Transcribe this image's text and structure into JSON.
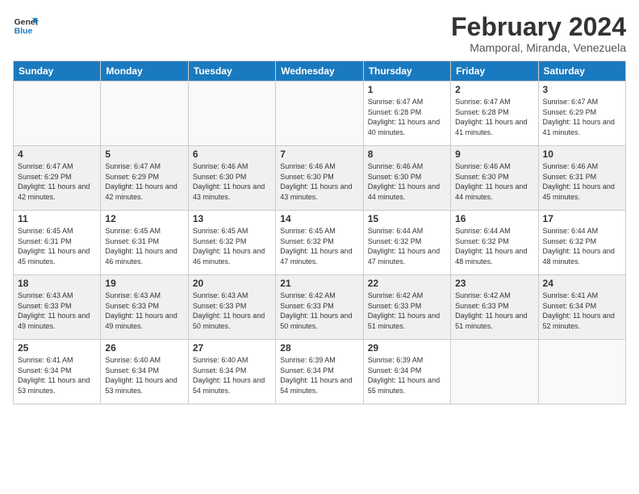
{
  "logo": {
    "line1": "General",
    "line2": "Blue"
  },
  "title": "February 2024",
  "subtitle": "Mamporal, Miranda, Venezuela",
  "days_of_week": [
    "Sunday",
    "Monday",
    "Tuesday",
    "Wednesday",
    "Thursday",
    "Friday",
    "Saturday"
  ],
  "weeks": [
    [
      {
        "day": "",
        "info": ""
      },
      {
        "day": "",
        "info": ""
      },
      {
        "day": "",
        "info": ""
      },
      {
        "day": "",
        "info": ""
      },
      {
        "day": "1",
        "info": "Sunrise: 6:47 AM\nSunset: 6:28 PM\nDaylight: 11 hours and 40 minutes."
      },
      {
        "day": "2",
        "info": "Sunrise: 6:47 AM\nSunset: 6:28 PM\nDaylight: 11 hours and 41 minutes."
      },
      {
        "day": "3",
        "info": "Sunrise: 6:47 AM\nSunset: 6:29 PM\nDaylight: 11 hours and 41 minutes."
      }
    ],
    [
      {
        "day": "4",
        "info": "Sunrise: 6:47 AM\nSunset: 6:29 PM\nDaylight: 11 hours and 42 minutes."
      },
      {
        "day": "5",
        "info": "Sunrise: 6:47 AM\nSunset: 6:29 PM\nDaylight: 11 hours and 42 minutes."
      },
      {
        "day": "6",
        "info": "Sunrise: 6:46 AM\nSunset: 6:30 PM\nDaylight: 11 hours and 43 minutes."
      },
      {
        "day": "7",
        "info": "Sunrise: 6:46 AM\nSunset: 6:30 PM\nDaylight: 11 hours and 43 minutes."
      },
      {
        "day": "8",
        "info": "Sunrise: 6:46 AM\nSunset: 6:30 PM\nDaylight: 11 hours and 44 minutes."
      },
      {
        "day": "9",
        "info": "Sunrise: 6:46 AM\nSunset: 6:30 PM\nDaylight: 11 hours and 44 minutes."
      },
      {
        "day": "10",
        "info": "Sunrise: 6:46 AM\nSunset: 6:31 PM\nDaylight: 11 hours and 45 minutes."
      }
    ],
    [
      {
        "day": "11",
        "info": "Sunrise: 6:45 AM\nSunset: 6:31 PM\nDaylight: 11 hours and 45 minutes."
      },
      {
        "day": "12",
        "info": "Sunrise: 6:45 AM\nSunset: 6:31 PM\nDaylight: 11 hours and 46 minutes."
      },
      {
        "day": "13",
        "info": "Sunrise: 6:45 AM\nSunset: 6:32 PM\nDaylight: 11 hours and 46 minutes."
      },
      {
        "day": "14",
        "info": "Sunrise: 6:45 AM\nSunset: 6:32 PM\nDaylight: 11 hours and 47 minutes."
      },
      {
        "day": "15",
        "info": "Sunrise: 6:44 AM\nSunset: 6:32 PM\nDaylight: 11 hours and 47 minutes."
      },
      {
        "day": "16",
        "info": "Sunrise: 6:44 AM\nSunset: 6:32 PM\nDaylight: 11 hours and 48 minutes."
      },
      {
        "day": "17",
        "info": "Sunrise: 6:44 AM\nSunset: 6:32 PM\nDaylight: 11 hours and 48 minutes."
      }
    ],
    [
      {
        "day": "18",
        "info": "Sunrise: 6:43 AM\nSunset: 6:33 PM\nDaylight: 11 hours and 49 minutes."
      },
      {
        "day": "19",
        "info": "Sunrise: 6:43 AM\nSunset: 6:33 PM\nDaylight: 11 hours and 49 minutes."
      },
      {
        "day": "20",
        "info": "Sunrise: 6:43 AM\nSunset: 6:33 PM\nDaylight: 11 hours and 50 minutes."
      },
      {
        "day": "21",
        "info": "Sunrise: 6:42 AM\nSunset: 6:33 PM\nDaylight: 11 hours and 50 minutes."
      },
      {
        "day": "22",
        "info": "Sunrise: 6:42 AM\nSunset: 6:33 PM\nDaylight: 11 hours and 51 minutes."
      },
      {
        "day": "23",
        "info": "Sunrise: 6:42 AM\nSunset: 6:33 PM\nDaylight: 11 hours and 51 minutes."
      },
      {
        "day": "24",
        "info": "Sunrise: 6:41 AM\nSunset: 6:34 PM\nDaylight: 11 hours and 52 minutes."
      }
    ],
    [
      {
        "day": "25",
        "info": "Sunrise: 6:41 AM\nSunset: 6:34 PM\nDaylight: 11 hours and 53 minutes."
      },
      {
        "day": "26",
        "info": "Sunrise: 6:40 AM\nSunset: 6:34 PM\nDaylight: 11 hours and 53 minutes."
      },
      {
        "day": "27",
        "info": "Sunrise: 6:40 AM\nSunset: 6:34 PM\nDaylight: 11 hours and 54 minutes."
      },
      {
        "day": "28",
        "info": "Sunrise: 6:39 AM\nSunset: 6:34 PM\nDaylight: 11 hours and 54 minutes."
      },
      {
        "day": "29",
        "info": "Sunrise: 6:39 AM\nSunset: 6:34 PM\nDaylight: 11 hours and 55 minutes."
      },
      {
        "day": "",
        "info": ""
      },
      {
        "day": "",
        "info": ""
      }
    ]
  ]
}
